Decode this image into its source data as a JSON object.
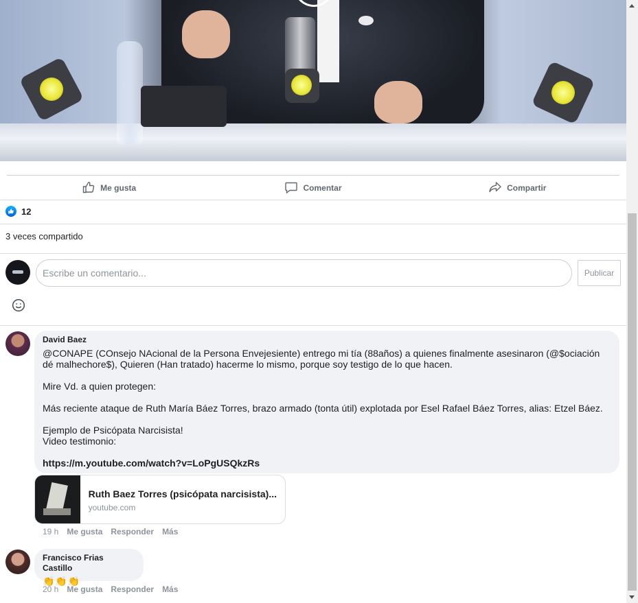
{
  "actions": {
    "like_label": "Me gusta",
    "comment_label": "Comentar",
    "share_label": "Compartir"
  },
  "reactions": {
    "count": "12"
  },
  "shares": {
    "text": "3 veces compartido"
  },
  "composer": {
    "placeholder": "Escribe un comentario...",
    "publish_label": "Publicar"
  },
  "comments": [
    {
      "author": "David Baez",
      "lines": [
        "@CONAPE (COnsejo NAcional de la Persona Envejesiente) entrego mi tía (88años) a quienes finalmente asesinaron (@$ociación dé malhechore$), Quieren (Han tratado) hacerme lo mismo, porque soy testigo de lo que hacen.",
        "Mire Vd. a quien protegen:",
        "Más reciente ataque de Ruth María Báez Torres, brazo armado (tonta útil) explotada por Esel Rafael Báez Torres, alias: Etzel Báez.",
        "Ejemplo de Psicópata Narcisista!",
        "Video testimonio:",
        "https://m.youtube.com/watch?v=LoPgUSQkzRs"
      ],
      "preview": {
        "title": "Ruth Baez Torres (psicópata narcisista)...",
        "domain": "youtube.com"
      },
      "time": "19 h",
      "like_label": "Me gusta",
      "reply_label": "Responder",
      "more_label": "Más"
    },
    {
      "author": "Francisco Frias Castillo",
      "emojis": "👏👏👏",
      "time": "20 h",
      "like_label": "Me gusta",
      "reply_label": "Responder",
      "more_label": "Más"
    }
  ],
  "colors": {
    "accent_like": "#1877f2",
    "muted_text": "#606770",
    "bubble_bg": "#f0f2f5"
  }
}
